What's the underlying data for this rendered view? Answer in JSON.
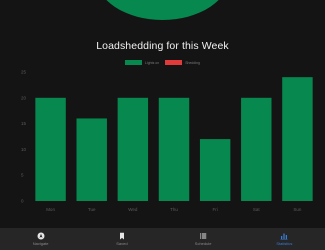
{
  "colors": {
    "background": "#141414",
    "accent_green": "#07884f",
    "shedding_red": "#e03a3a",
    "nav_background": "#262626",
    "nav_active": "#3a7bd5",
    "nav_inactive": "#8a8a8a"
  },
  "chart_data": {
    "type": "bar",
    "title": "Loadshedding for this Week",
    "legend": [
      "Lights on",
      "Shedding"
    ],
    "legend_placement": "top-center",
    "categories": [
      "Mon",
      "Tue",
      "Wed",
      "Thu",
      "Fri",
      "Sat",
      "Sun"
    ],
    "series": [
      {
        "name": "Lights on",
        "values": [
          20,
          16,
          20,
          20,
          12,
          20,
          24
        ]
      }
    ],
    "yticks": [
      0,
      5,
      10,
      15,
      20,
      25
    ],
    "ylim": [
      0,
      25
    ],
    "grid": false
  },
  "nav": {
    "items": [
      {
        "label": "Navigate",
        "icon": "navigate-icon",
        "active": false
      },
      {
        "label": "Saved",
        "icon": "bookmark-icon",
        "active": false
      },
      {
        "label": "Schedule",
        "icon": "list-icon",
        "active": false
      },
      {
        "label": "Statistics",
        "icon": "bar-chart-icon",
        "active": true
      }
    ]
  }
}
